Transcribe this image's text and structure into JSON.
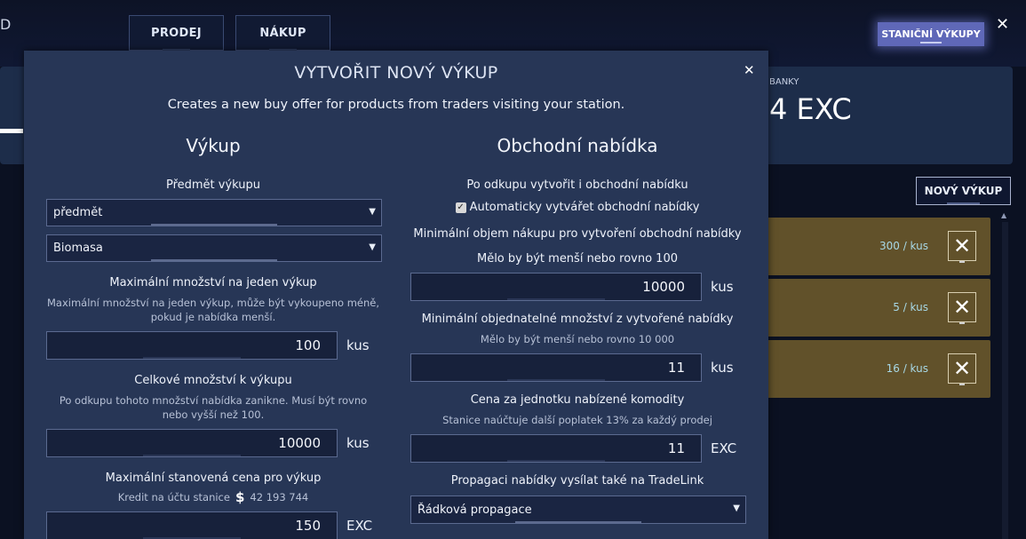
{
  "header": {
    "partial_left_text": "D",
    "tabs": [
      {
        "label": "PRODEJ"
      },
      {
        "label": "NÁKUP"
      }
    ],
    "station_button": "STANIČNÍ VÝKUPY",
    "close_icon": "✕"
  },
  "bank": {
    "label": "BANKY",
    "value": "4 EXC"
  },
  "offers": {
    "new_button": "NOVÝ VÝKUP",
    "rows": [
      {
        "price": "300 / kus"
      },
      {
        "price": "5 / kus"
      },
      {
        "price": "16 / kus"
      }
    ],
    "row_color": "#61512a"
  },
  "modal": {
    "title": "VYTVOŘIT NOVÝ VÝKUP",
    "close_icon": "✕",
    "subtitle": "Creates a new buy offer for products from traders visiting your station.",
    "left": {
      "heading": "Výkup",
      "subject_label": "Předmět výkupu",
      "subject_type": "předmět",
      "subject_item": "Biomasa",
      "max_per_label": "Maximální množství na jeden výkup",
      "max_per_hint1": "Maximální množství na jeden výkup, může být vykoupeno méně,",
      "max_per_hint2": "pokud je nabídka menší.",
      "max_per_value": "100",
      "max_per_unit": "kus",
      "total_label": "Celkové množství k výkupu",
      "total_hint1": "Po odkupu tohoto množství nabídka zanikne. Musí být rovno",
      "total_hint2": "nebo vyšší než 100.",
      "total_value": "10000",
      "total_unit": "kus",
      "max_price_label": "Maximální stanovená cena pro výkup",
      "credit_label": "Kredit na účtu stanice",
      "credit_value": "42 193 744",
      "max_price_value": "150",
      "max_price_unit": "EXC"
    },
    "right": {
      "heading": "Obchodní nabídka",
      "after_label": "Po odkupu vytvořit i obchodní nabídku",
      "auto_check_label": "Automaticky vytvářet obchodní nabídky",
      "auto_checked": true,
      "min_volume_label": "Minimální objem nákupu pro vytvoření obchodní nabídky",
      "min_volume_hint": "Mělo by být menší nebo rovno 100",
      "min_volume_value": "10000",
      "min_volume_unit": "kus",
      "min_order_label": "Minimální objednatelné množství z vytvořené nabídky",
      "min_order_hint": "Mělo by být menší nebo rovno 10 000",
      "min_order_value": "11",
      "min_order_unit": "kus",
      "unit_price_label": "Cena za jednotku nabízené komodity",
      "unit_price_hint": "Stanice naúčtuje další poplatek 13% za každý prodej",
      "unit_price_value": "11",
      "unit_price_unit": "EXC",
      "tradelink_label": "Propagaci nabídky vysílat také na TradeLink",
      "tradelink_option": "Řádková propagace"
    }
  }
}
